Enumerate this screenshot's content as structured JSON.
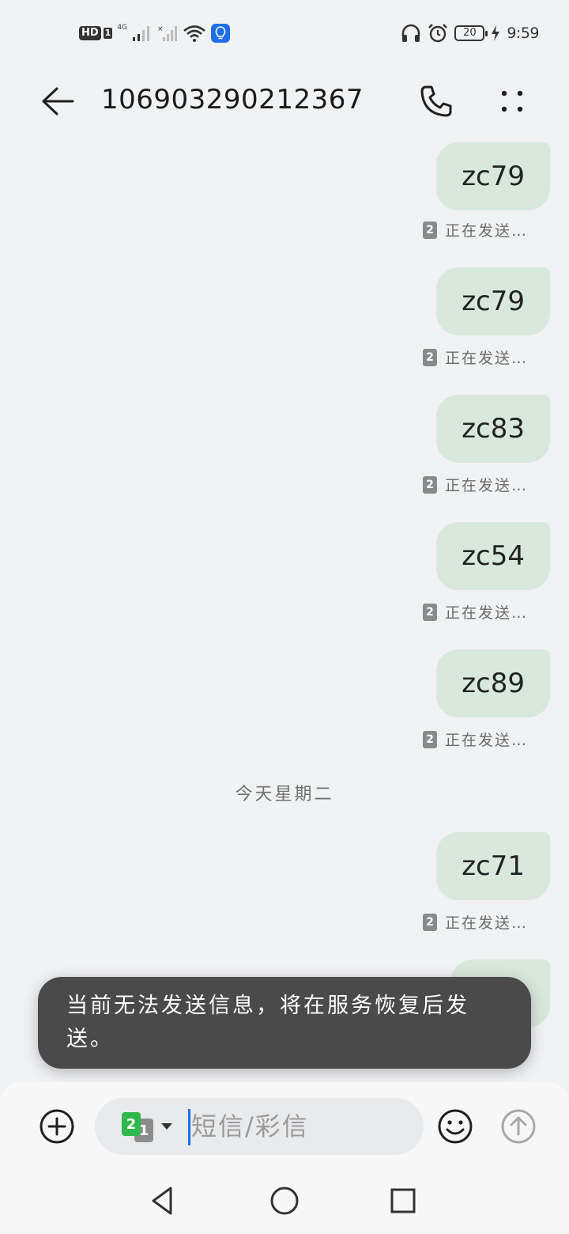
{
  "status_bar": {
    "hd_label": "HD",
    "sim1_label": "1",
    "network_label": "4G",
    "battery_level": "20",
    "time": "9:59",
    "icons": [
      "signal-icon",
      "wifi-icon",
      "lightbulb-icon",
      "headphones-icon",
      "alarm-icon",
      "battery-icon",
      "charging-icon"
    ]
  },
  "header": {
    "title": "106903290212367",
    "back_icon": "back-arrow-icon",
    "call_icon": "phone-icon",
    "more_icon": "more-dots-icon"
  },
  "messages": [
    {
      "text": "zc79",
      "sim": "2",
      "status": "正在发送…"
    },
    {
      "text": "zc79",
      "sim": "2",
      "status": "正在发送…"
    },
    {
      "text": "zc83",
      "sim": "2",
      "status": "正在发送…"
    },
    {
      "text": "zc54",
      "sim": "2",
      "status": "正在发送…"
    },
    {
      "text": "zc89",
      "sim": "2",
      "status": "正在发送…"
    }
  ],
  "date_separator": "今天星期二",
  "messages_today": [
    {
      "text": "zc71",
      "sim": "2",
      "status": "正在发送…"
    }
  ],
  "toast": {
    "text": "当前无法发送信息，将在服务恢复后发送。"
  },
  "composer": {
    "placeholder": "短信/彩信",
    "value": "",
    "selected_sim_front": "2",
    "selected_sim_back": "1"
  },
  "nav": {
    "icons": [
      "nav-back-icon",
      "nav-home-icon",
      "nav-recents-icon"
    ]
  },
  "colors": {
    "background": "#f1f2f4",
    "bubble": "#d9e8dd",
    "toast": "#4a4a4a",
    "accent": "#1e6ee8",
    "sim2": "#2fb84d"
  }
}
